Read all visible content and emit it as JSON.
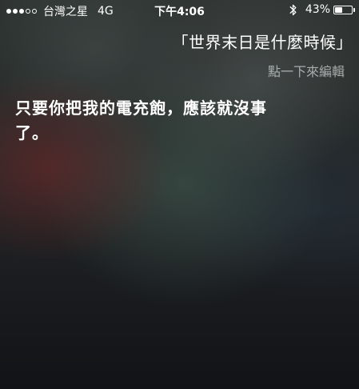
{
  "status_bar": {
    "signal_strength": 3,
    "signal_max": 5,
    "carrier": "台灣之星",
    "network": "4G",
    "time": "下午4:06",
    "bluetooth_icon": "bluetooth-icon",
    "battery_percent": "43%",
    "battery_level": 0.43
  },
  "siri": {
    "query": "「世界末日是什麼時候」",
    "edit_hint": "點一下來編輯",
    "response": "只要你把我的電充飽，應該就沒事了。"
  }
}
